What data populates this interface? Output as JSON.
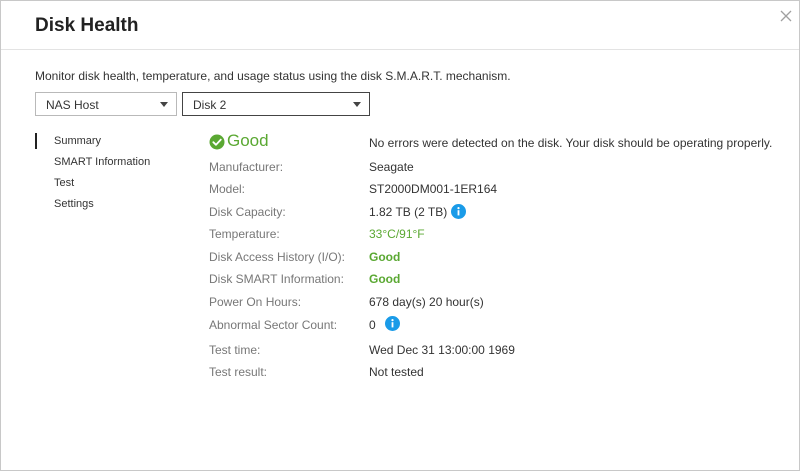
{
  "dialog": {
    "title": "Disk Health",
    "description": "Monitor disk health, temperature, and usage status using the disk S.M.A.R.T. mechanism."
  },
  "selectors": {
    "host": "NAS Host",
    "disk": "Disk 2"
  },
  "nav": {
    "items": [
      {
        "label": "Summary",
        "active": true
      },
      {
        "label": "SMART Information"
      },
      {
        "label": "Test"
      },
      {
        "label": "Settings"
      }
    ]
  },
  "summary": {
    "status": "Good",
    "status_message": "No errors were detected on the disk. Your disk should be operating properly.",
    "rows": [
      {
        "label": "Manufacturer:",
        "value": "Seagate"
      },
      {
        "label": "Model:",
        "value": "ST2000DM001-1ER164"
      },
      {
        "label": "Disk Capacity:",
        "value": "1.82 TB (2 TB)"
      },
      {
        "label": "Temperature:",
        "value": "33°C/91°F"
      },
      {
        "label": "Disk Access History (I/O):",
        "value": "Good"
      },
      {
        "label": "Disk SMART Information:",
        "value": "Good"
      },
      {
        "label": "Power On Hours:",
        "value": "678 day(s) 20 hour(s)"
      },
      {
        "label": "Abnormal Sector Count:",
        "value": "0"
      },
      {
        "label": "Test time:",
        "value": "Wed Dec 31 13:00:00 1969"
      },
      {
        "label": "Test result:",
        "value": "Not tested"
      }
    ]
  },
  "colors": {
    "good": "#5aa832",
    "info": "#1a9be8"
  },
  "icons": {
    "close": "close-icon",
    "status": "check-circle-icon",
    "info": "info-icon",
    "dropdown": "chevron-down-icon"
  }
}
